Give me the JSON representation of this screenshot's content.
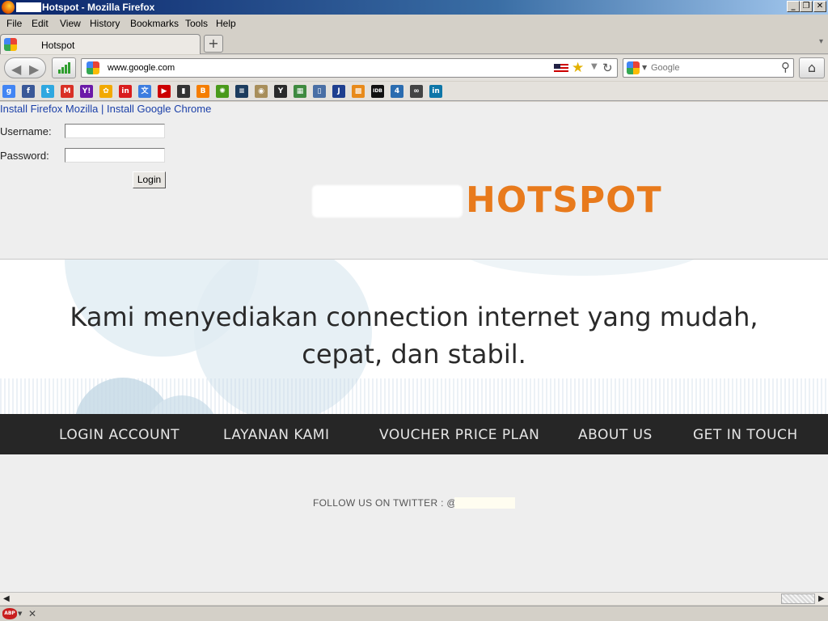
{
  "window": {
    "title": "Hotspot - Mozilla Firefox",
    "buttons": [
      "_",
      "❐",
      "✕"
    ]
  },
  "menubar": [
    "File",
    "Edit",
    "View",
    "History",
    "Bookmarks",
    "Tools",
    "Help"
  ],
  "tab": {
    "label": "Hotspot",
    "new_tab_label": "+",
    "list_all_tabs": "▾"
  },
  "navbar": {
    "back_icon": "◀",
    "forward_icon": "▶",
    "url": "www.google.com",
    "search_placeholder": "Google",
    "home_icon": "⌂"
  },
  "bookmarks": [
    {
      "icon": "google-icon",
      "color": "#4285f4",
      "glyph": "g"
    },
    {
      "icon": "facebook-icon",
      "color": "#3b5998",
      "glyph": "f"
    },
    {
      "icon": "twitter-icon",
      "color": "#2fa8e0",
      "glyph": "t"
    },
    {
      "icon": "gmail-icon",
      "color": "#d93025",
      "glyph": "M"
    },
    {
      "icon": "yahoo-icon",
      "color": "#6b1aa8",
      "glyph": "Y!"
    },
    {
      "icon": "msn-icon",
      "color": "#f2a900",
      "glyph": "✿"
    },
    {
      "icon": "inbox-icon",
      "color": "#d91d1d",
      "glyph": "in"
    },
    {
      "icon": "translate-icon",
      "color": "#3c7de0",
      "glyph": "文"
    },
    {
      "icon": "youtube-icon",
      "color": "#cc0000",
      "glyph": "▶"
    },
    {
      "icon": "tv-icon",
      "color": "#333333",
      "glyph": "▮"
    },
    {
      "icon": "blogger-icon",
      "color": "#f57d00",
      "glyph": "B"
    },
    {
      "icon": "bp-icon",
      "color": "#4a9a1a",
      "glyph": "✺"
    },
    {
      "icon": "news-icon",
      "color": "#1d3c5e",
      "glyph": "≡"
    },
    {
      "icon": "badge-icon",
      "color": "#a88e5a",
      "glyph": "◉"
    },
    {
      "icon": "newspaper-icon",
      "color": "#2a2a2a",
      "glyph": "Y"
    },
    {
      "icon": "puzzle-icon",
      "color": "#3f8a3f",
      "glyph": "▦"
    },
    {
      "icon": "document-icon",
      "color": "#4a6fa5",
      "glyph": "▯"
    },
    {
      "icon": "j-icon",
      "color": "#1f3f8f",
      "glyph": "J"
    },
    {
      "icon": "grid-icon",
      "color": "#e88a1a",
      "glyph": "▩"
    },
    {
      "icon": "imdb-icon",
      "color": "#111111",
      "glyph": "IDB"
    },
    {
      "icon": "channel-4-icon",
      "color": "#2b6cb0",
      "glyph": "4"
    },
    {
      "icon": "tripadvisor-icon",
      "color": "#444444",
      "glyph": "∞"
    },
    {
      "icon": "linkedin-icon",
      "color": "#0e76a8",
      "glyph": "in"
    }
  ],
  "page": {
    "install_firefox": "Install Firefox Mozilla",
    "link_separator": " | ",
    "install_chrome": "Install Google Chrome",
    "username_label": "Username:",
    "password_label": "Password:",
    "username_value": "",
    "password_value": "",
    "login_button": "Login",
    "logo_text": "HOTSPOT",
    "logo_color": "#e87a1c",
    "tagline_line1": "Kami menyediakan connection internet yang mudah,",
    "tagline_line2": "cepat, dan stabil.",
    "nav_items": [
      "LOGIN ACCOUNT",
      "LAYANAN KAMI",
      "VOUCHER PRICE PLAN",
      "ABOUT US",
      "GET IN TOUCH"
    ],
    "follow_text": "FOLLOW US ON TWITTER : @"
  },
  "scrollbar": {
    "left_arrow": "◀",
    "right_arrow": "▶"
  },
  "statusbar": {
    "adblock_label": "ABP",
    "close_icon": "✕"
  }
}
